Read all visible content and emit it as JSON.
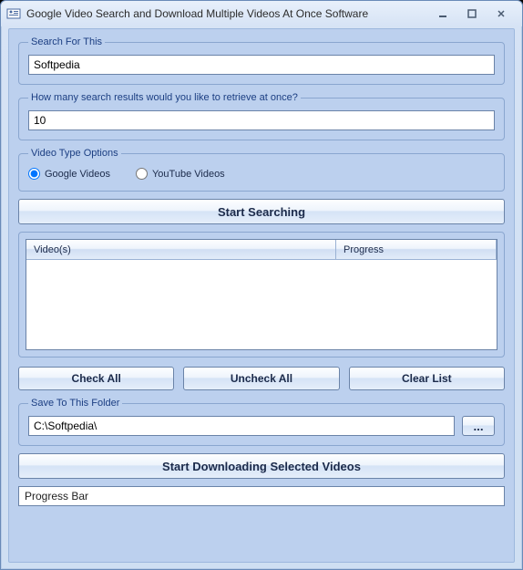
{
  "window": {
    "title": "Google Video Search and Download Multiple Videos At Once Software"
  },
  "search": {
    "legend": "Search For This",
    "value": "Softpedia"
  },
  "results": {
    "legend": "How many search results would you like to retrieve at once?",
    "value": "10"
  },
  "videoType": {
    "legend": "Video Type Options",
    "options": {
      "google": "Google Videos",
      "youtube": "YouTube Videos"
    }
  },
  "buttons": {
    "startSearch": "Start Searching",
    "checkAll": "Check All",
    "uncheckAll": "Uncheck All",
    "clearList": "Clear List",
    "browse": "...",
    "startDownload": "Start Downloading Selected Videos"
  },
  "list": {
    "colVideos": "Video(s)",
    "colProgress": "Progress"
  },
  "saveFolder": {
    "legend": "Save To This Folder",
    "value": "C:\\Softpedia\\"
  },
  "progressBar": {
    "label": "Progress Bar"
  }
}
